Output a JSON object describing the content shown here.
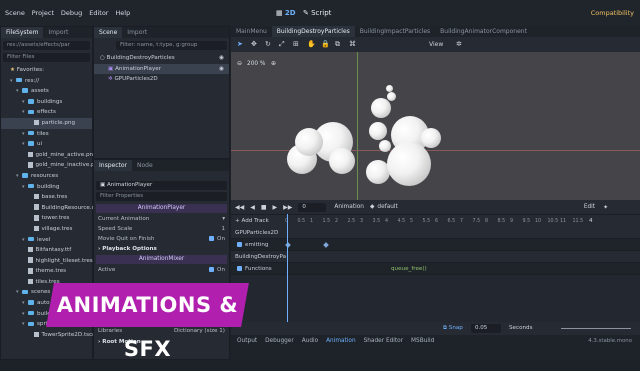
{
  "menubar": {
    "items": [
      "Scene",
      "Project",
      "Debug",
      "Editor",
      "Help"
    ],
    "workspace_2d": "2D",
    "workspace_script": "Script",
    "compatibility": "Compatibility"
  },
  "filesystem": {
    "tabs": [
      "FileSystem",
      "Import"
    ],
    "path": "res://assets/effects/par",
    "filter_placeholder": "Filter Files",
    "rows": [
      {
        "label": "Favorites:",
        "type": "fav",
        "indent": 0
      },
      {
        "label": "res://",
        "type": "folder",
        "indent": 1
      },
      {
        "label": "assets",
        "type": "folder",
        "indent": 2
      },
      {
        "label": "buildings",
        "type": "folder",
        "indent": 3
      },
      {
        "label": "effects",
        "type": "folder",
        "indent": 3
      },
      {
        "label": "particle.png",
        "type": "file",
        "indent": 4,
        "selected": true
      },
      {
        "label": "tiles",
        "type": "folder",
        "indent": 3
      },
      {
        "label": "ui",
        "type": "folder",
        "indent": 3
      },
      {
        "label": "gold_mine_active.png",
        "type": "file",
        "indent": 3
      },
      {
        "label": "gold_mine_inactive.p...",
        "type": "file",
        "indent": 3
      },
      {
        "label": "resources",
        "type": "folder",
        "indent": 2
      },
      {
        "label": "building",
        "type": "folder",
        "indent": 3
      },
      {
        "label": "base.tres",
        "type": "file",
        "indent": 4
      },
      {
        "label": "BuildingResource.cs",
        "type": "file",
        "indent": 4
      },
      {
        "label": "tower.tres",
        "type": "file",
        "indent": 4
      },
      {
        "label": "village.tres",
        "type": "file",
        "indent": 4
      },
      {
        "label": "level",
        "type": "folder",
        "indent": 3
      },
      {
        "label": "Bitfantasy.ttf",
        "type": "file",
        "indent": 3
      },
      {
        "label": "highlight_tileset.tres",
        "type": "file",
        "indent": 3
      },
      {
        "label": "theme.tres",
        "type": "file",
        "indent": 3
      },
      {
        "label": "tiles.tres",
        "type": "file",
        "indent": 3
      },
      {
        "label": "scenes",
        "type": "folder",
        "indent": 2
      },
      {
        "label": "auto",
        "type": "folder",
        "indent": 3
      },
      {
        "label": "build",
        "type": "folder",
        "indent": 3
      },
      {
        "label": "sprite",
        "type": "folder",
        "indent": 3
      },
      {
        "label": "TowerSprite2D.tscn",
        "type": "file",
        "indent": 4
      }
    ]
  },
  "scene": {
    "tabs": [
      "Scene",
      "Import"
    ],
    "filter_placeholder": "Filter: name, t:type, g:group",
    "nodes": [
      {
        "label": "BuildingDestroyParticles",
        "indent": 0
      },
      {
        "label": "AnimationPlayer",
        "indent": 1,
        "selected": true
      },
      {
        "label": "GPUParticles2D",
        "indent": 1
      }
    ]
  },
  "inspector": {
    "tabs": [
      "Inspector",
      "Node"
    ],
    "node_name": "AnimationPlayer",
    "filter_placeholder": "Filter Properties",
    "section_player": "AnimationPlayer",
    "rows": [
      {
        "label": "Current Animation",
        "value": ""
      },
      {
        "label": "Speed Scale",
        "value": "1"
      },
      {
        "label": "Movie Quit on Finish",
        "value": "On"
      }
    ],
    "playback_options": "Playback Options",
    "section_mixer": "AnimationMixer",
    "active_label": "Active",
    "active_value": "On",
    "libraries_label": "Libraries",
    "libraries_value": "Dictionary (size 1)",
    "root_motion": "Root Motion"
  },
  "editor_tabs": [
    "MainMenu",
    "BuildingDestroyParticles",
    "BuildingImpactParticles",
    "BuildingAnimatorComponent"
  ],
  "viewport": {
    "zoom": "200 %",
    "view_label": "View"
  },
  "animation": {
    "time_value": "0",
    "animation_label": "Animation",
    "current_animation": "default",
    "edit_label": "Edit",
    "add_track": "+ Add Track",
    "ruler_ticks": [
      "0",
      "0.5",
      "1",
      "1.5",
      "2",
      "2.5",
      "3",
      "3.5",
      "4",
      "4.5",
      "5",
      "5.5",
      "6",
      "6.5",
      "7",
      "7.5",
      "8",
      "8.5",
      "9",
      "9.5",
      "10",
      "10.5",
      "11",
      "11.5"
    ],
    "length": "4",
    "tracks": [
      {
        "label": "GPUParticles2D",
        "kind": "group"
      },
      {
        "label": "emitting",
        "kind": "prop"
      },
      {
        "label": "BuildingDestroyPa",
        "kind": "group"
      },
      {
        "label": "Functions",
        "kind": "prop",
        "key_label": "queue_free()"
      }
    ],
    "snap_label": "Snap",
    "snap_value": "0.05",
    "snap_unit": "Seconds"
  },
  "bottom_tabs": [
    "Output",
    "Debugger",
    "Audio",
    "Animation",
    "Shader Editor",
    "MSBuild"
  ],
  "version": "4.3.stable.mono",
  "banner": "ANIMATIONS & SFX",
  "colors": {
    "accent": "#6fb1ff",
    "banner": "#b11fae",
    "viewport_bg": "#444449"
  }
}
